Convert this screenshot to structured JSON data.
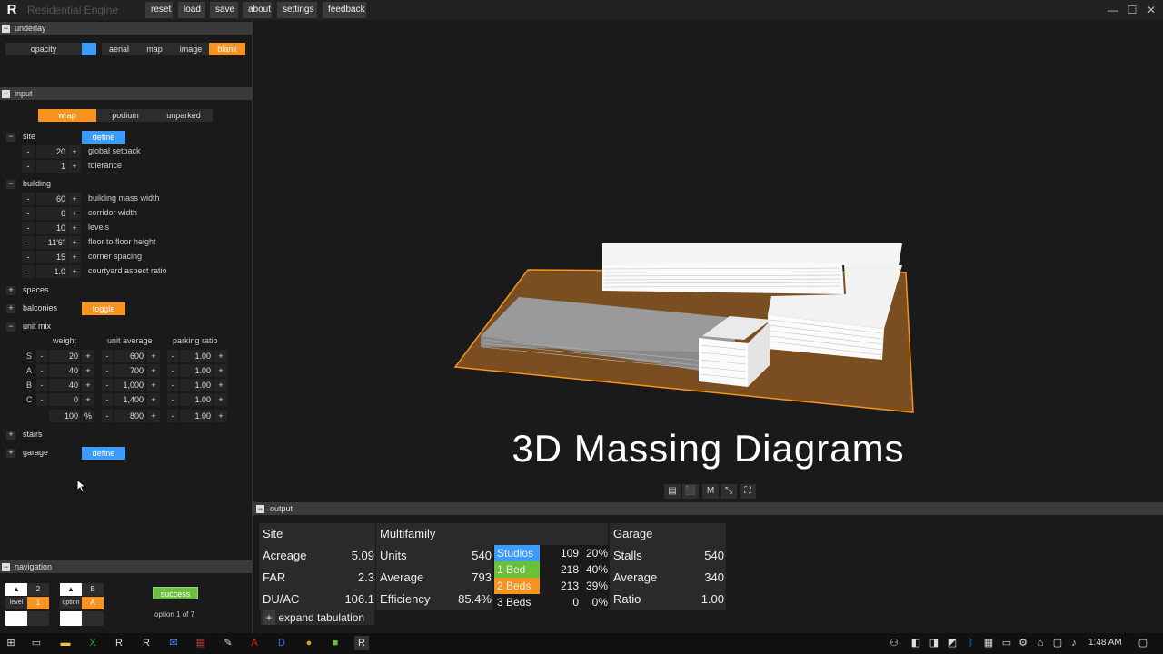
{
  "window": {
    "title": "Residential Engine",
    "menu": [
      "reset",
      "load",
      "save",
      "about",
      "settings",
      "feedback"
    ],
    "controls": [
      "—",
      "☐",
      "✕"
    ]
  },
  "underlay": {
    "header": "underlay",
    "opacity_label": "opacity",
    "options": [
      "aerial",
      "map",
      "image",
      "blank"
    ],
    "selected": "blank"
  },
  "input": {
    "header": "input",
    "types": [
      "wrap",
      "podium",
      "unparked"
    ],
    "selected_type": "wrap",
    "site": {
      "label": "site",
      "button": "define",
      "params": [
        {
          "value": "20",
          "label": "global setback"
        },
        {
          "value": "1",
          "label": "tolerance"
        }
      ]
    },
    "building": {
      "label": "building",
      "params": [
        {
          "value": "60",
          "label": "building mass width"
        },
        {
          "value": "6",
          "label": "corridor width"
        },
        {
          "value": "10",
          "label": "levels"
        },
        {
          "value": "11'6\"",
          "label": "floor to floor height"
        },
        {
          "value": "15",
          "label": "corner spacing"
        },
        {
          "value": "1.0",
          "label": "courtyard aspect ratio"
        }
      ]
    },
    "spaces": {
      "label": "spaces"
    },
    "balconies": {
      "label": "balconies",
      "button": "toggle"
    },
    "unit_mix": {
      "label": "unit mix",
      "columns": [
        "weight",
        "unit average",
        "parking ratio"
      ],
      "rows": [
        {
          "type": "S",
          "weight": "20",
          "avg": "600",
          "parking": "1.00"
        },
        {
          "type": "A",
          "weight": "40",
          "avg": "700",
          "parking": "1.00"
        },
        {
          "type": "B",
          "weight": "40",
          "avg": "1,000",
          "parking": "1.00"
        },
        {
          "type": "C",
          "weight": "0",
          "avg": "1,400",
          "parking": "1.00"
        }
      ],
      "totals": {
        "weight": "100",
        "unit": "%",
        "avg": "800",
        "parking": "1.00"
      }
    },
    "stairs": {
      "label": "stairs"
    },
    "garage": {
      "label": "garage",
      "button": "define"
    }
  },
  "navigation": {
    "header": "navigation",
    "level_label": "level",
    "level_up": "2",
    "level_value": "1",
    "option_label": "option",
    "option_up": "B",
    "option_value": "A",
    "status": "success",
    "option_text": "option 1 of 7"
  },
  "viewport": {
    "overlay_title": "3D Massing Diagrams",
    "view_buttons": [
      "▤",
      "⬛",
      "M",
      "⤡",
      "⛶"
    ]
  },
  "output": {
    "header": "output",
    "site": {
      "title": "Site",
      "rows": [
        {
          "label": "Acreage",
          "value": "5.09"
        },
        {
          "label": "FAR",
          "value": "2.3"
        },
        {
          "label": "DU/AC",
          "value": "106.1"
        }
      ]
    },
    "multifamily": {
      "title": "Multifamily",
      "rows": [
        {
          "label": "Units",
          "value": "540"
        },
        {
          "label": "Average",
          "value": "793"
        },
        {
          "label": "Efficiency",
          "value": "85.4%"
        }
      ],
      "mix": [
        {
          "label": "Studios",
          "count": "109",
          "pct": "20%",
          "color": "#3b9bff"
        },
        {
          "label": "1 Bed",
          "count": "218",
          "pct": "40%",
          "color": "#6bbf3a"
        },
        {
          "label": "2 Beds",
          "count": "213",
          "pct": "39%",
          "color": "#f7931e"
        },
        {
          "label": "3 Beds",
          "count": "0",
          "pct": "0%",
          "color": "#1a1a1a"
        }
      ]
    },
    "garage": {
      "title": "Garage",
      "rows": [
        {
          "label": "Stalls",
          "value": "540"
        },
        {
          "label": "Average",
          "value": "340"
        },
        {
          "label": "Ratio",
          "value": "1.00"
        }
      ]
    },
    "expand": "expand tabulation"
  },
  "taskbar": {
    "time": "1:48 AM"
  }
}
